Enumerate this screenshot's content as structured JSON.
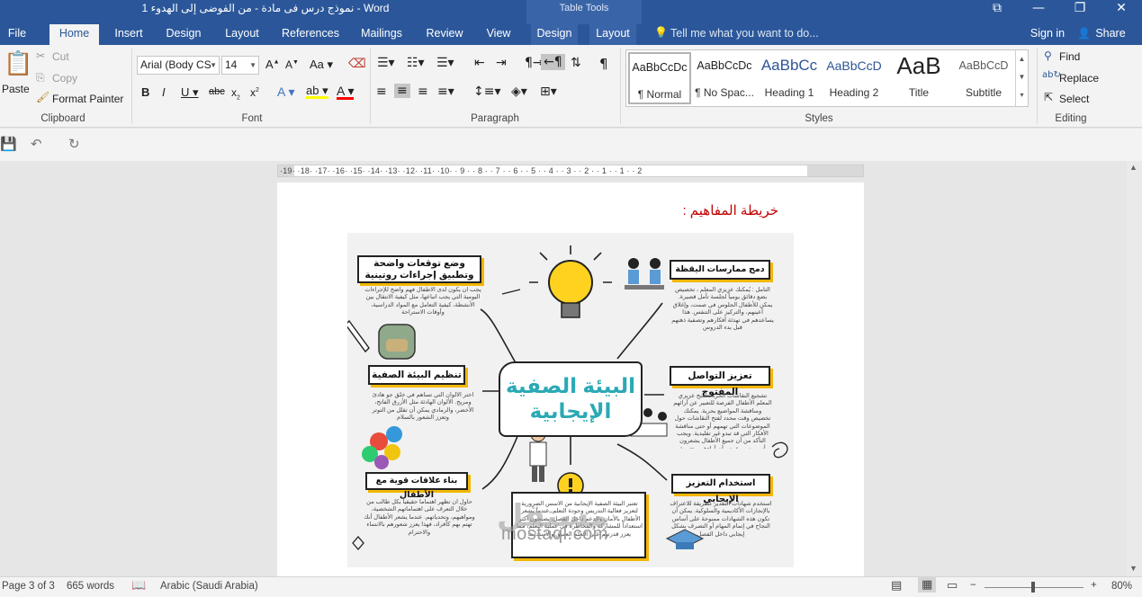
{
  "window": {
    "title": "نموذج درس فى مادة  - من الفوضى إلى الهدوء 1 - Word",
    "contextual_label": "Table Tools",
    "buttons": [
      "⧉",
      "—",
      "❐",
      "✕"
    ]
  },
  "tabs": {
    "file": "File",
    "home": "Home",
    "insert": "Insert",
    "design": "Design",
    "layout": "Layout",
    "references": "References",
    "mailings": "Mailings",
    "review": "Review",
    "view": "View",
    "table_design": "Design",
    "table_layout": "Layout",
    "tell_me": "Tell me what you want to do...",
    "sign_in": "Sign in",
    "share": "Share"
  },
  "ribbon": {
    "clipboard": {
      "label": "Clipboard",
      "paste": "Paste",
      "cut": "Cut",
      "copy": "Copy",
      "format_painter": "Format Painter"
    },
    "font": {
      "label": "Font",
      "family": "Arial (Body CS",
      "size": "14"
    },
    "paragraph": {
      "label": "Paragraph"
    },
    "styles": {
      "label": "Styles",
      "items": [
        {
          "sample": "AaBbCcDc",
          "name": "¶ Normal"
        },
        {
          "sample": "AaBbCcDc",
          "name": "¶ No Spac..."
        },
        {
          "sample": "AaBbCc",
          "name": "Heading 1"
        },
        {
          "sample": "AaBbCcD",
          "name": "Heading 2"
        },
        {
          "sample": "AaB",
          "name": "Title"
        },
        {
          "sample": "AaBbCcD",
          "name": "Subtitle"
        }
      ]
    },
    "editing": {
      "label": "Editing",
      "find": "Find",
      "replace": "Replace",
      "select": "Select"
    }
  },
  "ruler": {
    "ticks": "·19· ·18· ·17· ·16· ·15· ·14· ·13· ·12· ·11· ·10· · 9 · · 8 · · 7 · · 6 · · 5 · · 4 · · 3 · · 2 · · 1 · · 1 · · 2"
  },
  "document": {
    "heading": "خريطة المفاهيم :",
    "infographic": {
      "center_line1": "البيئة الصفية",
      "center_line2": "الإيجابية",
      "boxes": {
        "expectations_title": "وضع توقعات واضحة وتطبيق إجراءات روتينية",
        "expectations_text": "يجب أن يكون لدى الأطفال فهم واضح للإجراءات اليومية التي يجب اتباعها، مثل كيفية الانتقال بين الأنشطة، كيفية التعامل مع المواد الدراسية، وأوقات الاستراحة",
        "mindfulness_title": "دمج ممارسات اليقظة",
        "mindfulness_text": "التأمل : يُمكنك عزيزي المعلم ، تخصيص بضع دقائق يومياً لجلسة تأمل قصيرة. يمكن للأطفال الجلوس في صمت، وإغلاق أعينهم، والتركيز على التنفس. هذا يساعدهم في تهدئة أفكارهم وتصفية ذهنهم قبل بدء الدروس",
        "organize_title": "تنظيم البيئة الصفية",
        "organize_text": "اختر الألوان التي تساهم في خلق جو هادئ ومريح. الألوان الهادئة مثل الأزرق الفاتح، الأخضر، والرمادي يمكن أن تقلل من التوتر وتعزز الشعور بالسلام",
        "communication_title": "تعزيز التواصل المفتوح",
        "communication_text": "تشجيع النقاشات الحرة : امنح عزيزي المعلم الأطفال الفرصة للتعبير عن آرائهم ومناقشة المواضيع بحرية. يمكنك تخصيص وقت محدد لفتح النقاشات حول الموضوعات التي تهمهم أو حتى مناقشة الأفكار التي قد تبدو غير تقليدية. ويجب التأكد من أن جميع الأطفال يشعرون بأنهم مسموعون وأن آراءهم محترمة، حتى لو كانت مختلفة عن آراء الآخرين",
        "relations_title": "بناء علاقات قوية مع الأطفال",
        "relations_text": "حاول أن تظهر اهتماماً حقيقياً بكل طالب من خلال التعرف على اهتماماتهم الشخصية، ومواهبهم، وتحدياتهم. عندما يشعر الأطفال أنك تهتم بهم كأفراد، فهذا يعزز شعورهم بالانتماء والاحترام",
        "reinforcement_title": "استخدام التعزيز الإيجابي",
        "reinforcement_text": "استخدم شهادات التقدير كطريقة للاعتراف بالإنجازات الأكاديمية والسلوكية. يمكن أن تكون هذه الشهادات ممنوحة على أساس النجاح في إتمام المهام أو التصرف بشكل إيجابي داخل الفصل",
        "bottom_text": "تعتبر البيئة الصفية الإيجابية من الأسس الضرورية لتعزيز فعالية التدريس وجودة التعلم. عندما يشعر الأطفال بالأمان والدعم داخل الفصل، يصبحون أكثر استعداداً للمشاركة والمخاطرة في عملية التعلم، مما يعزز قدرتهم على التعلم العميق والاستدامة"
      },
      "watermark_ar": "مستقل",
      "watermark_en": "mostaql.com"
    }
  },
  "statusbar": {
    "page": "Page 3 of 3",
    "words": "665 words",
    "language": "Arabic (Saudi Arabia)",
    "zoom": "80%"
  },
  "colors": {
    "word_blue": "#2b579a",
    "heading_red": "#c00000",
    "center_teal": "#2aa9b5",
    "accent_yellow": "#f2b705"
  }
}
